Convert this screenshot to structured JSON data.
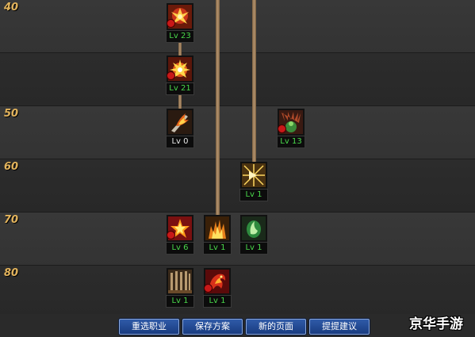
{
  "level_markers": [
    "40",
    "50",
    "60",
    "70",
    "80"
  ],
  "skills": {
    "s1": {
      "level": "Lv 23",
      "icon": "fire-burst-icon"
    },
    "s2": {
      "level": "Lv 21",
      "icon": "explosion-icon"
    },
    "s3": {
      "level": "Lv 0",
      "icon": "flaming-blade-icon"
    },
    "s4": {
      "level": "Lv 13",
      "icon": "green-spirit-icon"
    },
    "s5": {
      "level": "Lv 1",
      "icon": "radiant-burst-icon"
    },
    "s6": {
      "level": "Lv 6",
      "icon": "red-star-icon"
    },
    "s7": {
      "level": "Lv 1",
      "icon": "flame-pillar-icon"
    },
    "s8": {
      "level": "Lv 1",
      "icon": "green-orb-icon"
    },
    "s9": {
      "level": "Lv 1",
      "icon": "stone-gate-icon"
    },
    "s10": {
      "level": "Lv 1",
      "icon": "fire-dragon-icon"
    }
  },
  "buttons": {
    "reselect": "重选职业",
    "save": "保存方案",
    "new_page": "新的页面",
    "suggest": "提提建议"
  },
  "watermark": "京华手游",
  "colors": {
    "marker": "#e3b45c",
    "level_green": "#49d84a",
    "button": "#1f4a99"
  }
}
